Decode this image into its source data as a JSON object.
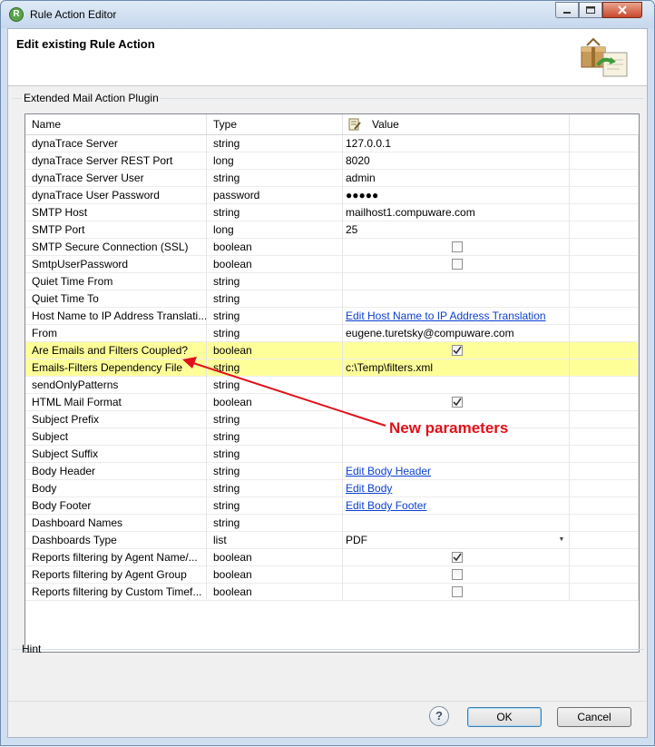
{
  "window": {
    "title": "Rule Action Editor",
    "app_icon_letter": "R"
  },
  "header": {
    "title": "Edit existing Rule Action"
  },
  "group": {
    "label": "Extended Mail Action Plugin"
  },
  "table": {
    "columns": {
      "name": "Name",
      "type": "Type",
      "value": "Value"
    },
    "rows": [
      {
        "name": "dynaTrace Server",
        "type": "string",
        "value": "127.0.0.1",
        "kind": "text"
      },
      {
        "name": "dynaTrace Server REST Port",
        "type": "long",
        "value": "8020",
        "kind": "text"
      },
      {
        "name": "dynaTrace Server User",
        "type": "string",
        "value": "admin",
        "kind": "text"
      },
      {
        "name": "dynaTrace User Password",
        "type": "password",
        "value": "●●●●●",
        "kind": "text"
      },
      {
        "name": "SMTP Host",
        "type": "string",
        "value": "mailhost1.compuware.com",
        "kind": "text"
      },
      {
        "name": "SMTP Port",
        "type": "long",
        "value": "25",
        "kind": "text"
      },
      {
        "name": "SMTP Secure Connection (SSL)",
        "type": "boolean",
        "value": "",
        "kind": "check",
        "checked": false
      },
      {
        "name": "SmtpUserPassword",
        "type": "boolean",
        "value": "",
        "kind": "check",
        "checked": false
      },
      {
        "name": "Quiet Time From",
        "type": "string",
        "value": "",
        "kind": "text"
      },
      {
        "name": "Quiet Time To",
        "type": "string",
        "value": "",
        "kind": "text"
      },
      {
        "name": "Host Name to IP Address Translati...",
        "type": "string",
        "value": "Edit Host Name to IP Address Translation",
        "kind": "link"
      },
      {
        "name": "From",
        "type": "string",
        "value": "eugene.turetsky@compuware.com",
        "kind": "text"
      },
      {
        "name": "Are Emails and Filters Coupled?",
        "type": "boolean",
        "value": "",
        "kind": "check",
        "checked": true,
        "highlight": true
      },
      {
        "name": "Emails-Filters Dependency File",
        "type": "string",
        "value": "c:\\Temp\\filters.xml",
        "kind": "text",
        "highlight": true
      },
      {
        "name": "sendOnlyPatterns",
        "type": "string",
        "value": "",
        "kind": "text"
      },
      {
        "name": "HTML Mail Format",
        "type": "boolean",
        "value": "",
        "kind": "check",
        "checked": true
      },
      {
        "name": "Subject Prefix",
        "type": "string",
        "value": "",
        "kind": "text"
      },
      {
        "name": "Subject",
        "type": "string",
        "value": "",
        "kind": "text"
      },
      {
        "name": "Subject Suffix",
        "type": "string",
        "value": "",
        "kind": "text"
      },
      {
        "name": "Body Header",
        "type": "string",
        "value": "Edit Body Header",
        "kind": "link"
      },
      {
        "name": "Body",
        "type": "string",
        "value": "Edit Body",
        "kind": "link"
      },
      {
        "name": "Body Footer",
        "type": "string",
        "value": "Edit Body Footer",
        "kind": "link"
      },
      {
        "name": "Dashboard Names",
        "type": "string",
        "value": "",
        "kind": "text"
      },
      {
        "name": "Dashboards Type",
        "type": "list",
        "value": "PDF",
        "kind": "combo"
      },
      {
        "name": "Reports filtering by Agent Name/...",
        "type": "boolean",
        "value": "",
        "kind": "check",
        "checked": true
      },
      {
        "name": "Reports filtering by Agent Group",
        "type": "boolean",
        "value": "",
        "kind": "check",
        "checked": false
      },
      {
        "name": "Reports filtering by Custom Timef...",
        "type": "boolean",
        "value": "",
        "kind": "check",
        "checked": false
      }
    ]
  },
  "annotation": {
    "text": "New parameters",
    "color": "#e0101a"
  },
  "hint": {
    "label": "Hint"
  },
  "buttons": {
    "help": "?",
    "ok": "OK",
    "cancel": "Cancel"
  }
}
